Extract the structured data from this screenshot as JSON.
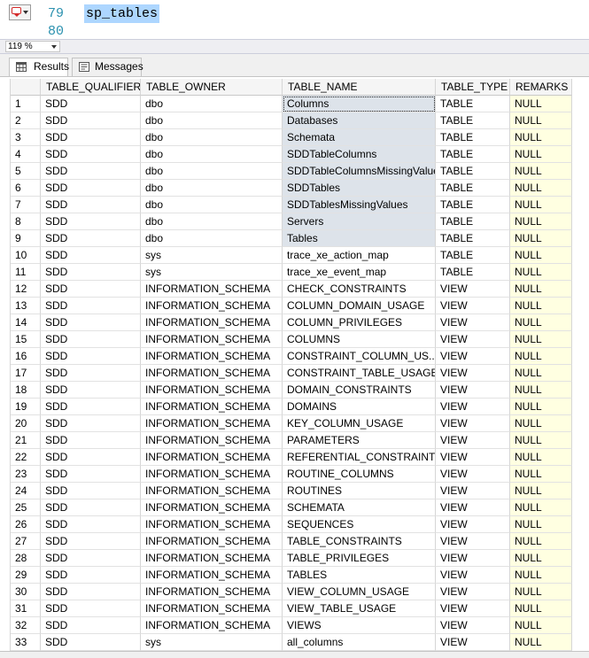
{
  "editor": {
    "line_numbers": [
      "79",
      "80"
    ],
    "code": "sp_tables"
  },
  "zoom": {
    "value": "119 %"
  },
  "tabs": [
    {
      "label": "Results",
      "icon": "grid-icon",
      "active": true
    },
    {
      "label": "Messages",
      "icon": "messages-icon",
      "active": false
    }
  ],
  "grid": {
    "columns": [
      "TABLE_QUALIFIER",
      "TABLE_OWNER",
      "TABLE_NAME",
      "TABLE_TYPE",
      "REMARKS"
    ],
    "rows": [
      [
        "1",
        "SDD",
        "dbo",
        "Columns",
        "TABLE",
        "NULL"
      ],
      [
        "2",
        "SDD",
        "dbo",
        "Databases",
        "TABLE",
        "NULL"
      ],
      [
        "3",
        "SDD",
        "dbo",
        "Schemata",
        "TABLE",
        "NULL"
      ],
      [
        "4",
        "SDD",
        "dbo",
        "SDDTableColumns",
        "TABLE",
        "NULL"
      ],
      [
        "5",
        "SDD",
        "dbo",
        "SDDTableColumnsMissingValues",
        "TABLE",
        "NULL"
      ],
      [
        "6",
        "SDD",
        "dbo",
        "SDDTables",
        "TABLE",
        "NULL"
      ],
      [
        "7",
        "SDD",
        "dbo",
        "SDDTablesMissingValues",
        "TABLE",
        "NULL"
      ],
      [
        "8",
        "SDD",
        "dbo",
        "Servers",
        "TABLE",
        "NULL"
      ],
      [
        "9",
        "SDD",
        "dbo",
        "Tables",
        "TABLE",
        "NULL"
      ],
      [
        "10",
        "SDD",
        "sys",
        "trace_xe_action_map",
        "TABLE",
        "NULL"
      ],
      [
        "11",
        "SDD",
        "sys",
        "trace_xe_event_map",
        "TABLE",
        "NULL"
      ],
      [
        "12",
        "SDD",
        "INFORMATION_SCHEMA",
        "CHECK_CONSTRAINTS",
        "VIEW",
        "NULL"
      ],
      [
        "13",
        "SDD",
        "INFORMATION_SCHEMA",
        "COLUMN_DOMAIN_USAGE",
        "VIEW",
        "NULL"
      ],
      [
        "14",
        "SDD",
        "INFORMATION_SCHEMA",
        "COLUMN_PRIVILEGES",
        "VIEW",
        "NULL"
      ],
      [
        "15",
        "SDD",
        "INFORMATION_SCHEMA",
        "COLUMNS",
        "VIEW",
        "NULL"
      ],
      [
        "16",
        "SDD",
        "INFORMATION_SCHEMA",
        "CONSTRAINT_COLUMN_US...",
        "VIEW",
        "NULL"
      ],
      [
        "17",
        "SDD",
        "INFORMATION_SCHEMA",
        "CONSTRAINT_TABLE_USAGE",
        "VIEW",
        "NULL"
      ],
      [
        "18",
        "SDD",
        "INFORMATION_SCHEMA",
        "DOMAIN_CONSTRAINTS",
        "VIEW",
        "NULL"
      ],
      [
        "19",
        "SDD",
        "INFORMATION_SCHEMA",
        "DOMAINS",
        "VIEW",
        "NULL"
      ],
      [
        "20",
        "SDD",
        "INFORMATION_SCHEMA",
        "KEY_COLUMN_USAGE",
        "VIEW",
        "NULL"
      ],
      [
        "21",
        "SDD",
        "INFORMATION_SCHEMA",
        "PARAMETERS",
        "VIEW",
        "NULL"
      ],
      [
        "22",
        "SDD",
        "INFORMATION_SCHEMA",
        "REFERENTIAL_CONSTRAINTS",
        "VIEW",
        "NULL"
      ],
      [
        "23",
        "SDD",
        "INFORMATION_SCHEMA",
        "ROUTINE_COLUMNS",
        "VIEW",
        "NULL"
      ],
      [
        "24",
        "SDD",
        "INFORMATION_SCHEMA",
        "ROUTINES",
        "VIEW",
        "NULL"
      ],
      [
        "25",
        "SDD",
        "INFORMATION_SCHEMA",
        "SCHEMATA",
        "VIEW",
        "NULL"
      ],
      [
        "26",
        "SDD",
        "INFORMATION_SCHEMA",
        "SEQUENCES",
        "VIEW",
        "NULL"
      ],
      [
        "27",
        "SDD",
        "INFORMATION_SCHEMA",
        "TABLE_CONSTRAINTS",
        "VIEW",
        "NULL"
      ],
      [
        "28",
        "SDD",
        "INFORMATION_SCHEMA",
        "TABLE_PRIVILEGES",
        "VIEW",
        "NULL"
      ],
      [
        "29",
        "SDD",
        "INFORMATION_SCHEMA",
        "TABLES",
        "VIEW",
        "NULL"
      ],
      [
        "30",
        "SDD",
        "INFORMATION_SCHEMA",
        "VIEW_COLUMN_USAGE",
        "VIEW",
        "NULL"
      ],
      [
        "31",
        "SDD",
        "INFORMATION_SCHEMA",
        "VIEW_TABLE_USAGE",
        "VIEW",
        "NULL"
      ],
      [
        "32",
        "SDD",
        "INFORMATION_SCHEMA",
        "VIEWS",
        "VIEW",
        "NULL"
      ],
      [
        "33",
        "SDD",
        "sys",
        "all_columns",
        "VIEW",
        "NULL"
      ]
    ],
    "selected_rows_in_name_column": [
      "1",
      "2",
      "3",
      "4",
      "5",
      "6",
      "7",
      "8",
      "9"
    ],
    "colors": {
      "null_cell": "#ffffe1",
      "selected_cell": "#dde3ea",
      "code_highlight": "#add6ff",
      "line_number": "#2b91af"
    }
  }
}
